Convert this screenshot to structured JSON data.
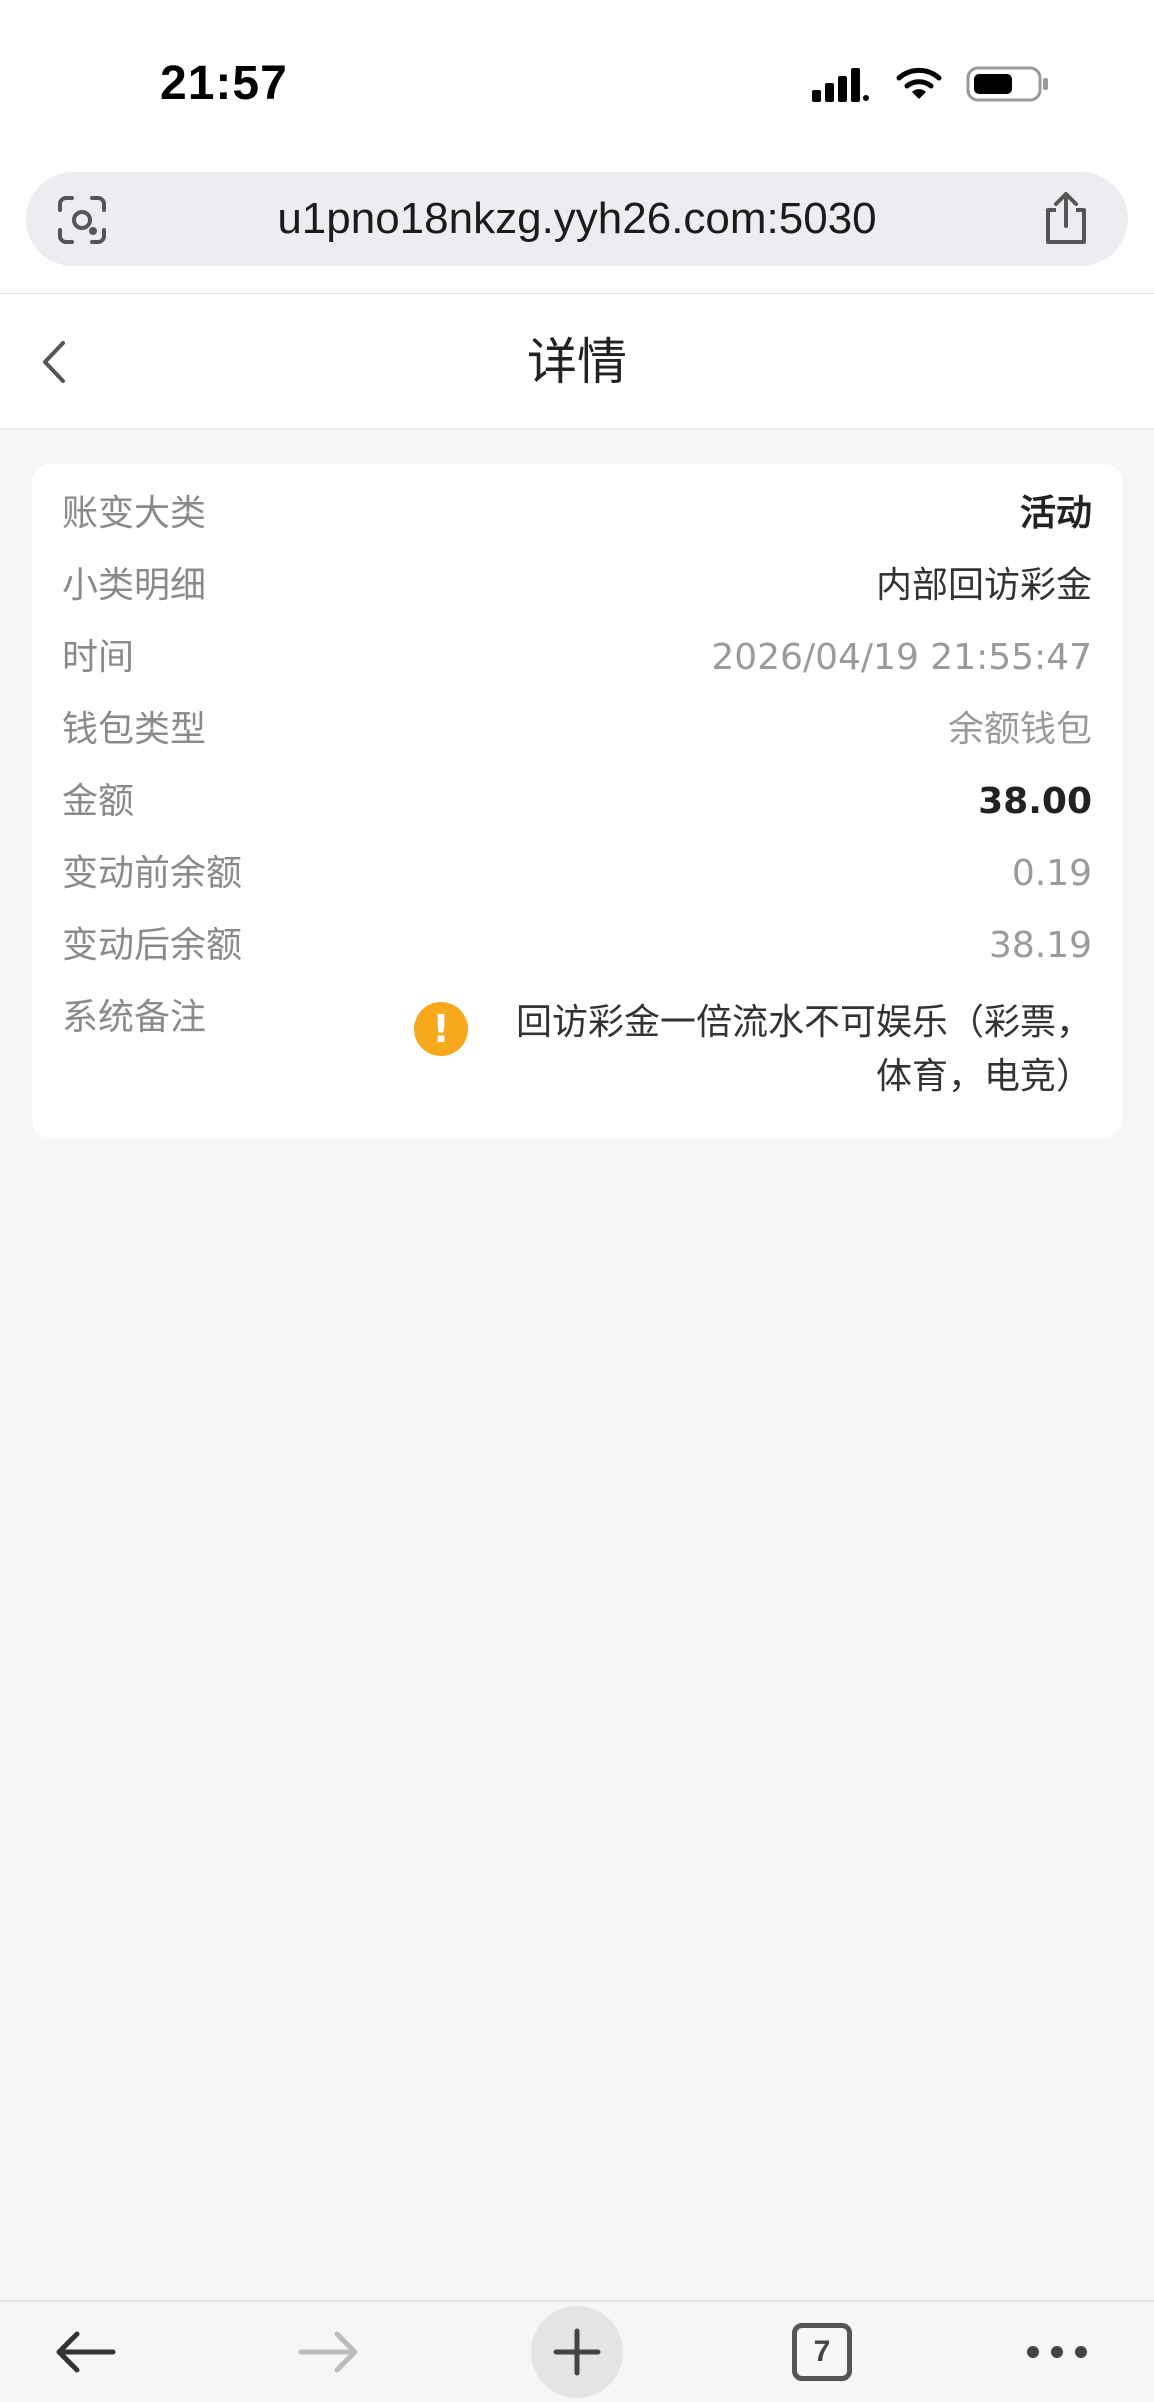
{
  "status_bar": {
    "time": "21:57"
  },
  "browser": {
    "url": "u1pno18nkzg.yyh26.com:5030",
    "tab_count": "7"
  },
  "header": {
    "title": "详情"
  },
  "detail": {
    "rows": [
      {
        "label": "账变大类",
        "value": "活动"
      },
      {
        "label": "小类明细",
        "value": "内部回访彩金"
      },
      {
        "label": "时间",
        "value": "2026/04/19 21:55:47"
      },
      {
        "label": "钱包类型",
        "value": "余额钱包"
      },
      {
        "label": "金额",
        "value": "38.00"
      },
      {
        "label": "变动前余额",
        "value": "0.19"
      },
      {
        "label": "变动后余额",
        "value": "38.19"
      },
      {
        "label": "系统备注",
        "value": "回访彩金一倍流水不可娱乐（彩票，体育，电竞）"
      }
    ],
    "note_icon_color": "#f7a81b"
  }
}
